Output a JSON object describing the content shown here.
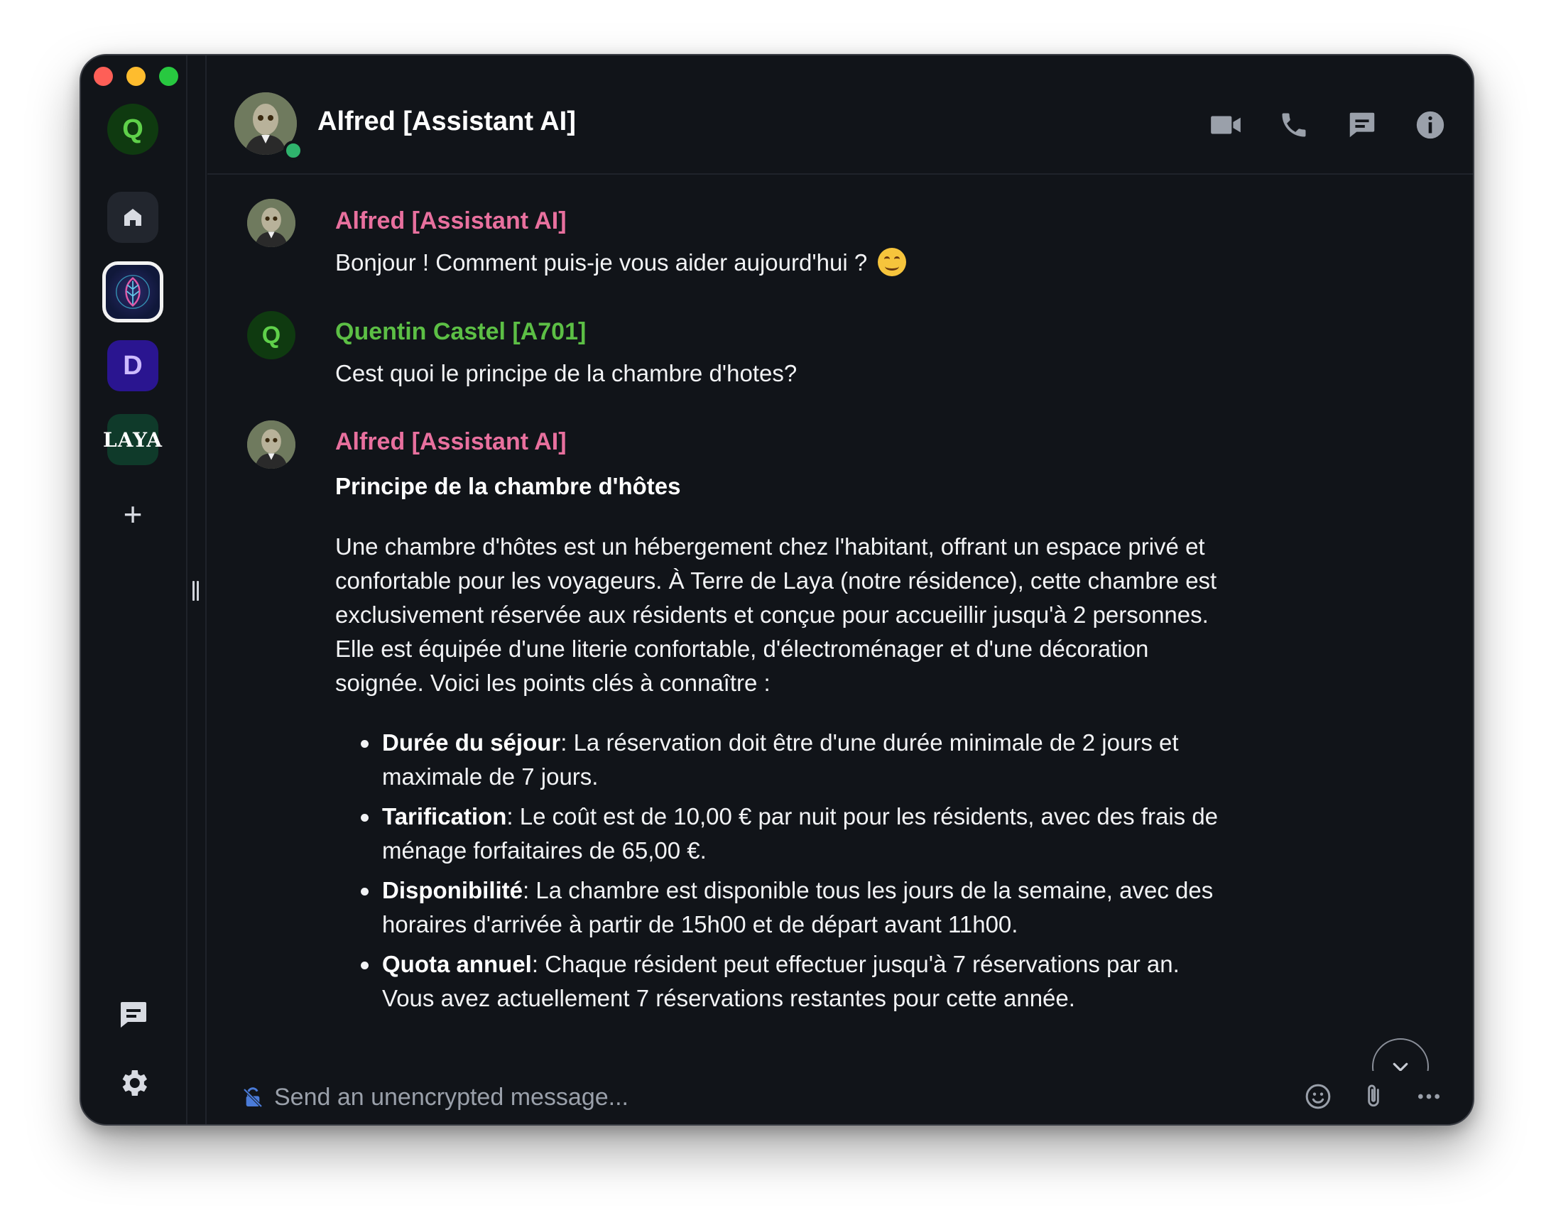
{
  "window": {
    "traffic_lights": [
      "close",
      "minimize",
      "zoom"
    ]
  },
  "sidebar": {
    "spaces": [
      {
        "id": "q",
        "label": "Q",
        "color": "#5fd04a"
      },
      {
        "id": "home",
        "icon": "home-icon"
      },
      {
        "id": "ai",
        "icon": "ai-leaf-logo",
        "selected": true
      },
      {
        "id": "d",
        "label": "D",
        "color": "#2a1590"
      },
      {
        "id": "laya",
        "label": "LAYA"
      },
      {
        "id": "add",
        "label": "+"
      }
    ],
    "bottom_icons": [
      "threads-icon",
      "settings-icon"
    ]
  },
  "header": {
    "title": "Alfred [Assistant AI]",
    "online": true,
    "actions": [
      "video-call-icon",
      "voice-call-icon",
      "threads-icon",
      "info-icon"
    ]
  },
  "timeline": {
    "messages": [
      {
        "sender": "Alfred [Assistant AI]",
        "sender_color": "#e8709e",
        "text": "Bonjour ! Comment puis-je vous aider aujourd'hui ?",
        "emoji": "smiling-face"
      },
      {
        "sender": "Quentin Castel [A701]",
        "sender_color": "#5cbf45",
        "avatar_letter": "Q",
        "text": "Cest quoi le principe de la chambre d'hotes?"
      },
      {
        "sender": "Alfred [Assistant AI]",
        "sender_color": "#e8709e",
        "heading": "Principe de la chambre d'hôtes",
        "paragraph": "Une chambre d'hôtes est un hébergement chez l'habitant, offrant un espace privé et\nconfortable pour les voyageurs. À Terre de Laya (notre résidence), cette chambre est\nexclusivement réservée aux résidents et conçue pour accueillir jusqu'à 2 personnes.\nElle est équipée d'une literie confortable, d'électroménager et d'une décoration\nsoignée. Voici les points clés à connaître :",
        "bullets": [
          {
            "term": "Durée du séjour",
            "text": ": La réservation doit être d'une durée minimale de 2 jours et\nmaximale de 7 jours."
          },
          {
            "term": "Tarification",
            "text": ": Le coût est de 10,00 € par nuit pour les résidents, avec des frais de\nménage forfaitaires de 65,00 €."
          },
          {
            "term": "Disponibilité",
            "text": ": La chambre est disponible tous les jours de la semaine, avec des\nhoraires d'arrivée à partir de 15h00 et de départ avant 11h00."
          },
          {
            "term": "Quota annuel",
            "text": ": Chaque résident peut effectuer jusqu'à 7 réservations par an.\nVous avez actuellement 7 réservations restantes pour cette année."
          }
        ]
      }
    ]
  },
  "composer": {
    "placeholder": "Send an unencrypted message...",
    "value": "",
    "actions": [
      "emoji-icon",
      "attachment-icon",
      "more-options-icon"
    ]
  }
}
